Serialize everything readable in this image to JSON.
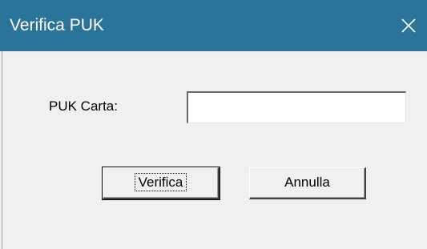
{
  "window": {
    "title": "Verifica PUK",
    "titlebar_color": "#2b7499",
    "close_icon": "close-icon"
  },
  "form": {
    "puk_label": "PUK Carta:",
    "puk_value": ""
  },
  "buttons": {
    "verify_label": "Verifica",
    "cancel_label": "Annulla"
  }
}
